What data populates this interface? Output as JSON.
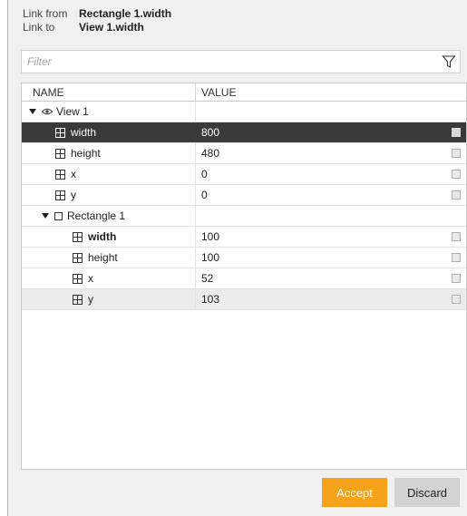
{
  "link": {
    "from_label": "Link from",
    "from_value": "Rectangle 1.width",
    "to_label": "Link to",
    "to_value": "View 1.width"
  },
  "filter": {
    "placeholder": "Filter"
  },
  "table": {
    "col_name": "NAME",
    "col_value": "VALUE",
    "rows": [
      {
        "label": "View 1",
        "value": ""
      },
      {
        "label": "width",
        "value": "800"
      },
      {
        "label": "height",
        "value": "480"
      },
      {
        "label": "x",
        "value": "0"
      },
      {
        "label": "y",
        "value": "0"
      },
      {
        "label": "Rectangle 1",
        "value": ""
      },
      {
        "label": "width",
        "value": "100"
      },
      {
        "label": "height",
        "value": "100"
      },
      {
        "label": "x",
        "value": "52"
      },
      {
        "label": "y",
        "value": "103"
      }
    ]
  },
  "buttons": {
    "accept": "Accept",
    "discard": "Discard"
  },
  "colors": {
    "accent": "#f7a21b",
    "selected_row": "#3a3a3a"
  }
}
